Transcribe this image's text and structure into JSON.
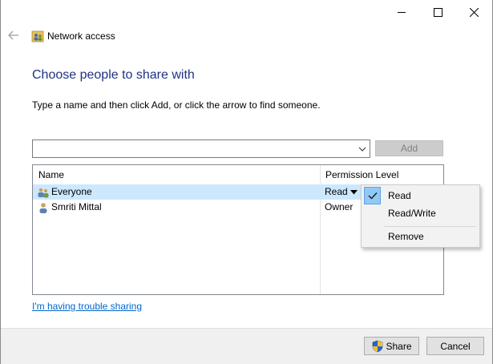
{
  "window": {
    "title": "Network access",
    "minimize_icon": "minimize-icon",
    "maximize_icon": "maximize-icon",
    "close_icon": "close-icon",
    "back_icon": "back-arrow-icon"
  },
  "main": {
    "heading": "Choose people to share with",
    "instructions": "Type a name and then click Add, or click the arrow to find someone.",
    "name_input": {
      "value": "",
      "placeholder": ""
    },
    "add_label": "Add"
  },
  "list": {
    "columns": [
      "Name",
      "Permission Level"
    ],
    "rows": [
      {
        "name": "Everyone",
        "permission": "Read",
        "icon": "group-users-icon",
        "selected": true
      },
      {
        "name": "Smriti Mittal",
        "permission": "Owner",
        "icon": "user-icon",
        "selected": false
      }
    ]
  },
  "permission_menu": {
    "items": [
      {
        "label": "Read",
        "checked": true
      },
      {
        "label": "Read/Write",
        "checked": false
      },
      {
        "label": "Remove",
        "checked": false
      }
    ]
  },
  "trouble_link": "I'm having trouble sharing",
  "footer": {
    "share_label": "Share",
    "cancel_label": "Cancel"
  },
  "colors": {
    "heading": "#1e3287",
    "link": "#0066cc",
    "selection": "#cce8ff",
    "menu_check_bg": "#90c8f6"
  }
}
